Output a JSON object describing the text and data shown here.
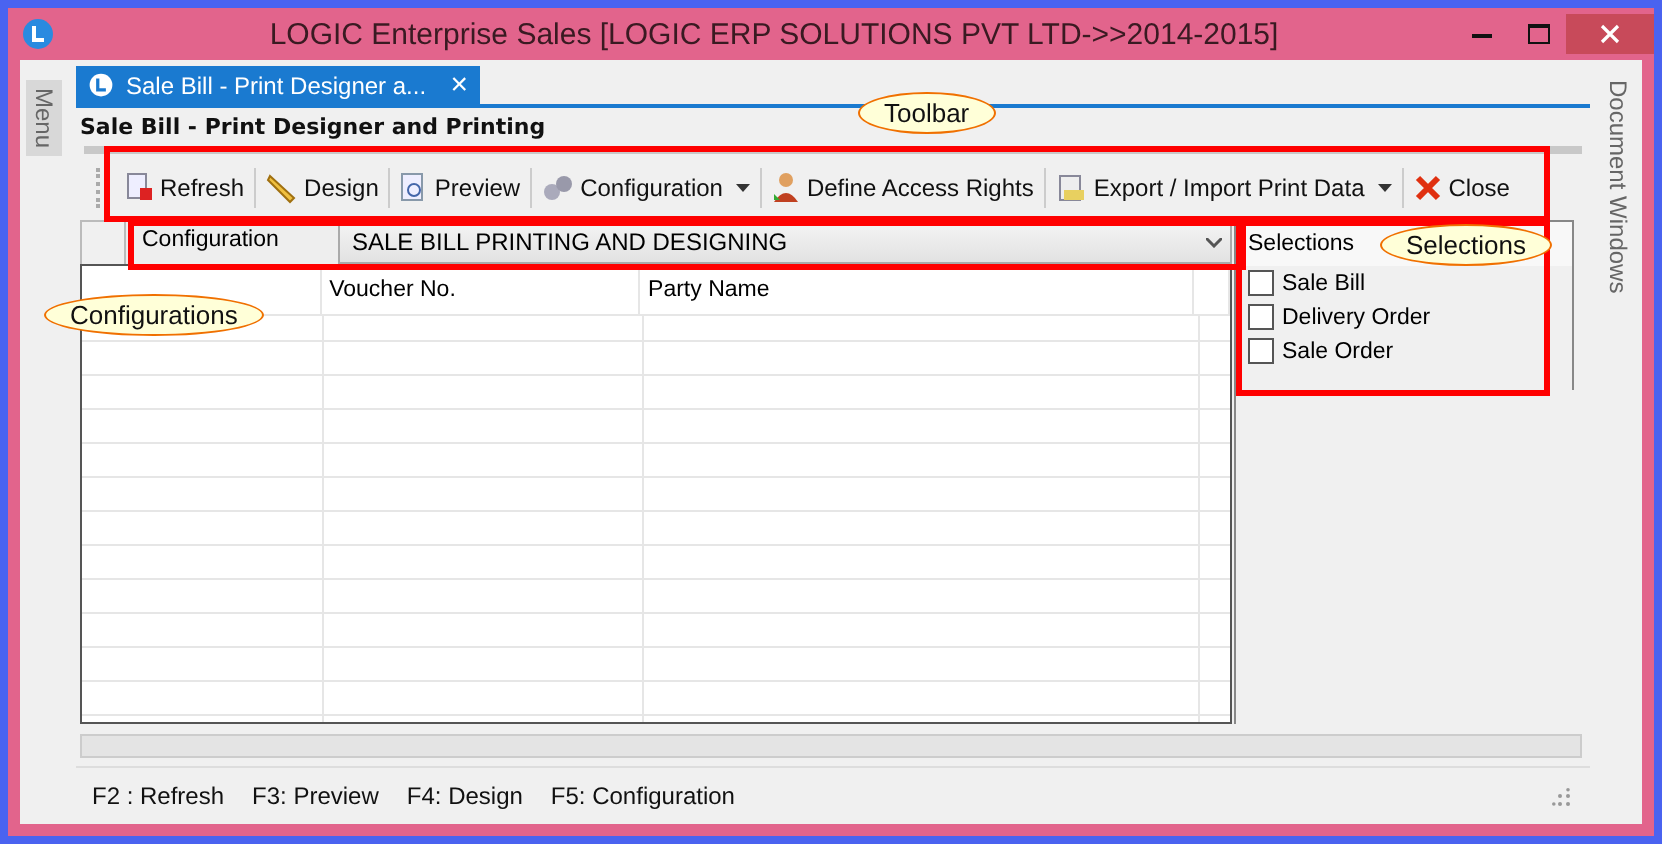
{
  "window": {
    "title": "LOGIC Enterprise Sales  [LOGIC ERP SOLUTIONS PVT LTD->>2014-2015]"
  },
  "side_left": {
    "label": "Menu"
  },
  "side_right": {
    "label": "Document Windows"
  },
  "tab": {
    "label": "Sale Bill - Print Designer a...",
    "close": "×",
    "selected": true
  },
  "heading": "Sale Bill - Print Designer and Printing",
  "toolbar": [
    {
      "label": "Refresh",
      "dropdown": false
    },
    {
      "label": "Design",
      "dropdown": false
    },
    {
      "label": "Preview",
      "dropdown": false
    },
    {
      "label": "Configuration",
      "dropdown": true
    },
    {
      "label": "Define Access Rights",
      "dropdown": false
    },
    {
      "label": "Export / Import Print Data",
      "dropdown": true
    },
    {
      "label": "Close",
      "dropdown": false
    }
  ],
  "configuration": {
    "label": "Configuration",
    "value": "SALE BILL PRINTING AND DESIGNING"
  },
  "table": {
    "columns": [
      "",
      "Voucher No.",
      "Party Name"
    ]
  },
  "selections": {
    "title": "Selections",
    "items": [
      {
        "label": "Sale Bill",
        "checked": false
      },
      {
        "label": "Delivery Order",
        "checked": false
      },
      {
        "label": "Sale Order",
        "checked": false
      }
    ]
  },
  "status_bar": [
    "F2 : Refresh",
    "F3:  Preview",
    "F4: Design",
    "F5: Configuration"
  ],
  "callouts": [
    {
      "text": "Toolbar"
    },
    {
      "text": "Selections"
    },
    {
      "text": "Configurations"
    }
  ]
}
